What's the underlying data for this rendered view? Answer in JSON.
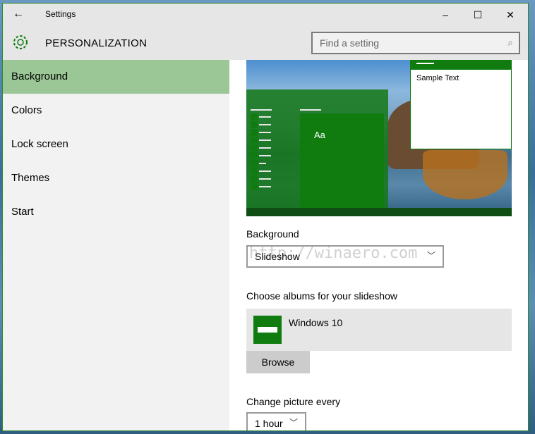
{
  "window": {
    "title": "Settings",
    "minimize": "–",
    "maximize": "☐",
    "close": "✕",
    "back": "←"
  },
  "header": {
    "title": "PERSONALIZATION",
    "search_placeholder": "Find a setting"
  },
  "sidebar": {
    "items": [
      {
        "label": "Background",
        "selected": true
      },
      {
        "label": "Colors"
      },
      {
        "label": "Lock screen"
      },
      {
        "label": "Themes"
      },
      {
        "label": "Start"
      }
    ]
  },
  "preview": {
    "tile_text": "Aa",
    "sample_text": "Sample Text"
  },
  "background": {
    "label": "Background",
    "value": "Slideshow"
  },
  "albums": {
    "label": "Choose albums for your slideshow",
    "items": [
      {
        "name": "Windows 10"
      }
    ],
    "browse": "Browse"
  },
  "interval": {
    "label": "Change picture every",
    "value": "1 hour"
  },
  "watermark": "http://winaero.com",
  "colors": {
    "accent": "#107c10",
    "selected_nav": "#9bc796"
  }
}
